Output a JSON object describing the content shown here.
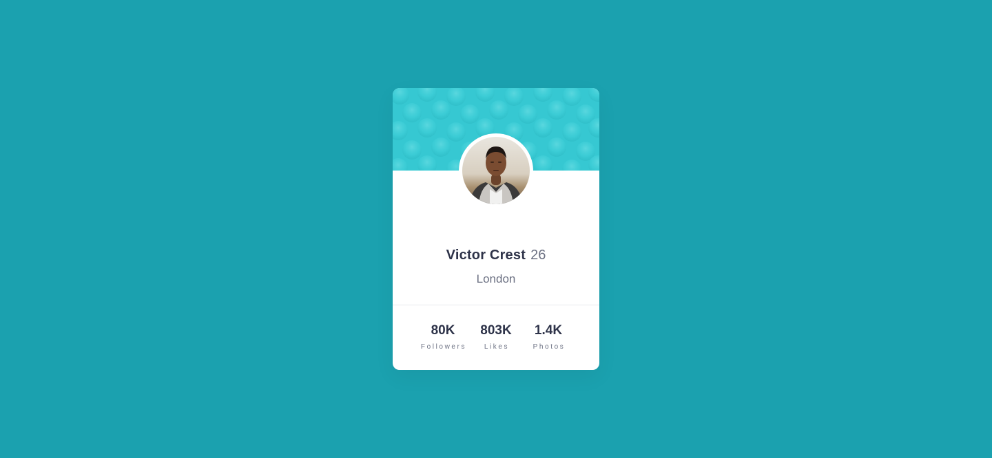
{
  "colors": {
    "background": "#1ba1af",
    "header_pattern": "#36c8d2",
    "card": "#ffffff",
    "text_dark": "#2e3349",
    "text_muted": "#6b7082"
  },
  "profile": {
    "name": "Victor Crest",
    "age": "26",
    "city": "London",
    "avatar_icon": "user-photo-icon"
  },
  "stats": [
    {
      "value": "80K",
      "label": "Followers"
    },
    {
      "value": "803K",
      "label": "Likes"
    },
    {
      "value": "1.4K",
      "label": "Photos"
    }
  ]
}
